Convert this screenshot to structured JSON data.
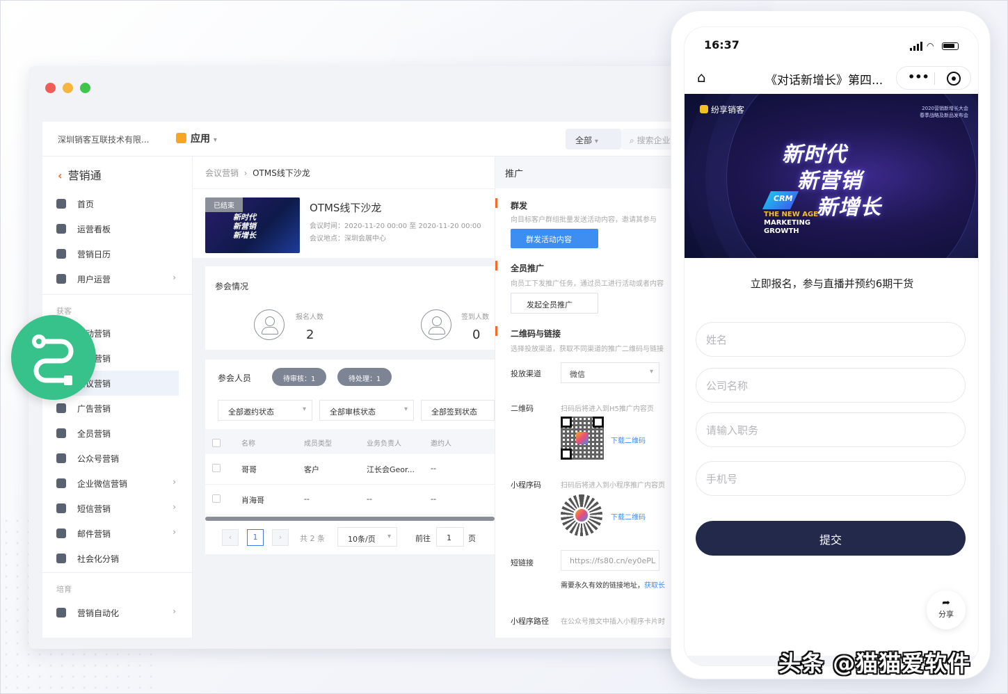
{
  "window": {
    "controls": [
      "close",
      "minimize",
      "maximize"
    ]
  },
  "topbar": {
    "company": "深圳销客互联技术有限...",
    "app_label": "应用",
    "filter_label": "全部",
    "search_placeholder": "搜索企业"
  },
  "sidebar": {
    "title": "营销通",
    "items": [
      {
        "label": "首页",
        "icon": "home-icon"
      },
      {
        "label": "运营看板",
        "icon": "dashboard-icon"
      },
      {
        "label": "营销日历",
        "icon": "calendar-icon"
      },
      {
        "label": "用户运营",
        "icon": "user-ops-icon",
        "has_children": true
      }
    ],
    "group1": "获客",
    "items2": [
      {
        "label": "活动营销",
        "icon": "event-icon"
      },
      {
        "label": "直播营销",
        "icon": "live-icon"
      },
      {
        "label": "会议营销",
        "icon": "meeting-icon",
        "active": true
      },
      {
        "label": "广告营销",
        "icon": "ad-icon"
      },
      {
        "label": "全员营销",
        "icon": "team-icon"
      },
      {
        "label": "公众号营销",
        "icon": "wechat-icon"
      },
      {
        "label": "企业微信营销",
        "icon": "wecom-icon",
        "has_children": true
      },
      {
        "label": "短信营销",
        "icon": "sms-icon",
        "has_children": true
      },
      {
        "label": "邮件营销",
        "icon": "mail-icon",
        "has_children": true
      },
      {
        "label": "社会化分销",
        "icon": "distribution-icon"
      }
    ],
    "group2": "培育",
    "items3": [
      {
        "label": "营销自动化",
        "icon": "automation-icon",
        "has_children": true
      }
    ]
  },
  "breadcrumb": {
    "parent": "会议营销",
    "current": "OTMS线下沙龙"
  },
  "event": {
    "status": "已结束",
    "name": "OTMS线下沙龙",
    "time": "会议时间：2020-11-20 00:00 至 2020-11-20 00:00",
    "place": "会议地点：深圳会展中心",
    "thumb_text": "新时代\n新营销\n新增长"
  },
  "stats": {
    "title": "参会情况",
    "registered_label": "报名人数",
    "registered_value": "2",
    "checked_label": "签到人数",
    "checked_value": "0"
  },
  "participants": {
    "title": "参会人员",
    "pill_pending_review": "待审核：1",
    "pill_pending_process": "待处理：1",
    "filters": [
      "全部邀约状态",
      "全部审核状态",
      "全部签到状态"
    ],
    "columns": [
      "名称",
      "成员类型",
      "业务负责人",
      "邀约人"
    ],
    "rows": [
      {
        "name": "哥哥",
        "type": "客户",
        "owner": "江长会Geor...",
        "inviter": "--"
      },
      {
        "name": "肖海哥",
        "type": "--",
        "owner": "--",
        "inviter": "--"
      }
    ],
    "pager": {
      "current": "1",
      "total": "共 2 条",
      "page_size": "10条/页",
      "goto_label": "前往",
      "goto_value": "1",
      "page_unit": "页"
    }
  },
  "promo": {
    "title": "推广",
    "group_send_title": "群发",
    "group_send_desc": "向目标客户群组批量发送活动内容，邀请其参与",
    "group_send_button": "群发活动内容",
    "staff_title": "全员推广",
    "staff_desc": "向员工下发推广任务，通过员工进行活动或者内容",
    "staff_button": "发起全员推广",
    "qr_title": "二维码与链接",
    "qr_desc": "选择投放渠道，获取不同渠道的推广二维码与链接",
    "channel_label": "投放渠道",
    "channel_value": "微信",
    "qrcode_label": "二维码",
    "qrcode_desc": "扫码后将进入到H5推广内容页",
    "qrcode_download": "下载二维码",
    "mini_label": "小程序码",
    "mini_desc": "扫码后将进入到小程序推广内容页",
    "mini_download": "下载二维码",
    "shortlink_label": "短链接",
    "shortlink_value": "https://fs80.cn/ey0ePL",
    "shortlink_hint": "需要永久有效的链接地址，",
    "shortlink_action": "获取长",
    "mini_path_label": "小程序路径",
    "mini_path_desc": "在公众号推文中插入小程序卡片时"
  },
  "phone": {
    "time": "16:37",
    "nav_title": "《对话新增长》第四...",
    "banner": {
      "brand": "纷享销客",
      "note_line1": "2020营销新增长大会",
      "note_line2": "春季战略及新品发布会",
      "slogan1": "新时代",
      "slogan2": "新营销",
      "slogan3": "新增长",
      "tag": "CRM",
      "eng1": "THE NEW AGE",
      "eng2": "MARKETING",
      "eng3": "GROWTH"
    },
    "form_title": "立即报名，参与直播并预约6期干货",
    "fields": [
      "姓名",
      "公司名称",
      "请输入职务",
      "手机号"
    ],
    "submit": "提交",
    "share": "分享"
  },
  "watermark": "头条 @猫猫爱软件",
  "colors": {
    "accent_orange": "#f56b2a",
    "link_blue": "#3d8ef0",
    "submit_navy": "#22294a",
    "logo_green": "#36c28a"
  }
}
